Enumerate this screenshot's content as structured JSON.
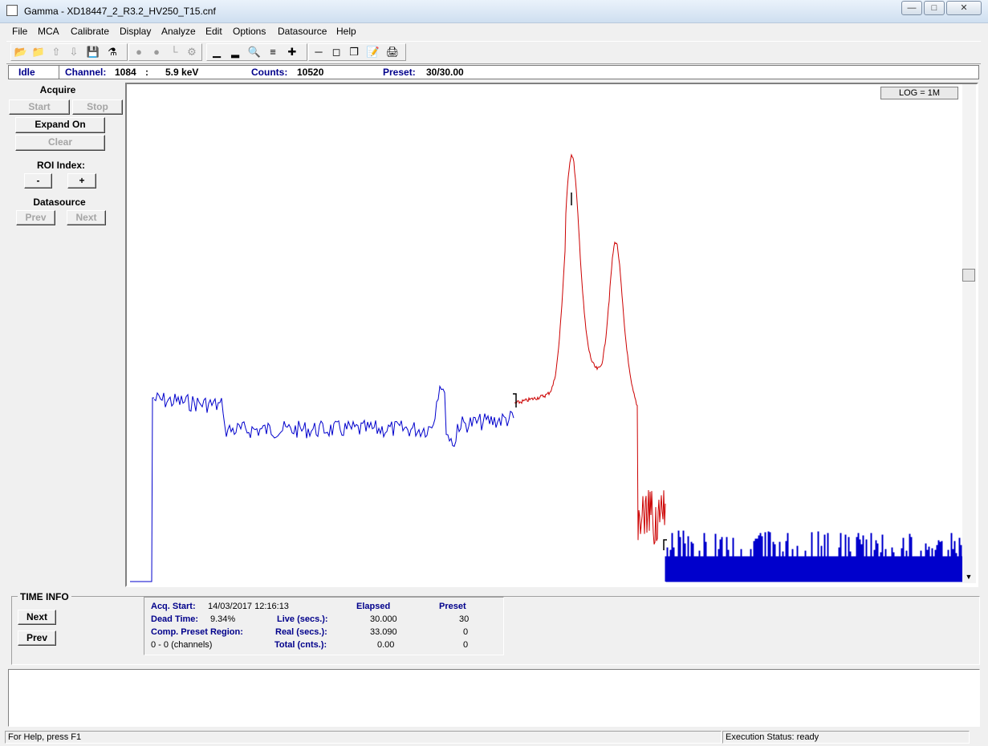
{
  "window": {
    "title": "Gamma - XD18447_2_R3.2_HV250_T15.cnf",
    "controls": [
      "—",
      "□",
      "✕"
    ]
  },
  "menu": [
    "File",
    "MCA",
    "Calibrate",
    "Display",
    "Analyze",
    "Edit",
    "Options",
    "Datasource",
    "Help"
  ],
  "status_strip": {
    "state": "Idle",
    "channel_label": "Channel:",
    "channel_value": "1084",
    "channel_sep": ":",
    "energy": "5.9 keV",
    "counts_label": "Counts:",
    "counts_value": "10520",
    "preset_label": "Preset:",
    "preset_value": "30/30.00"
  },
  "left_panel": {
    "acquire_label": "Acquire",
    "start": "Start",
    "stop": "Stop",
    "expand": "Expand On",
    "clear": "Clear",
    "roi_label": "ROI Index:",
    "roi_minus": "-",
    "roi_plus": "+",
    "datasource_label": "Datasource",
    "prev": "Prev",
    "next": "Next"
  },
  "spectrum": {
    "scale_label": "LOG = 1M",
    "roi_color": "#cc0000",
    "trace_color": "#0000cc"
  },
  "time_info": {
    "title": "TIME INFO",
    "next": "Next",
    "prev": "Prev",
    "acq_start_label": "Acq. Start:",
    "acq_start_value": "14/03/2017  12:16:13",
    "dead_time_label": "Dead Time:",
    "dead_time_value": "9.34%",
    "comp_preset_label": "Comp. Preset Region:",
    "comp_preset_value": "0 - 0 (channels)",
    "elapsed_header": "Elapsed",
    "preset_header": "Preset",
    "live_label": "Live (secs.):",
    "live_elapsed": "30.000",
    "live_preset": "30",
    "real_label": "Real (secs.):",
    "real_elapsed": "33.090",
    "real_preset": "0",
    "total_label": "Total (cnts.):",
    "total_elapsed": "0.00",
    "total_preset": "0"
  },
  "statusbar": {
    "help": "For Help, press F1",
    "execution": "Execution Status: ready"
  }
}
